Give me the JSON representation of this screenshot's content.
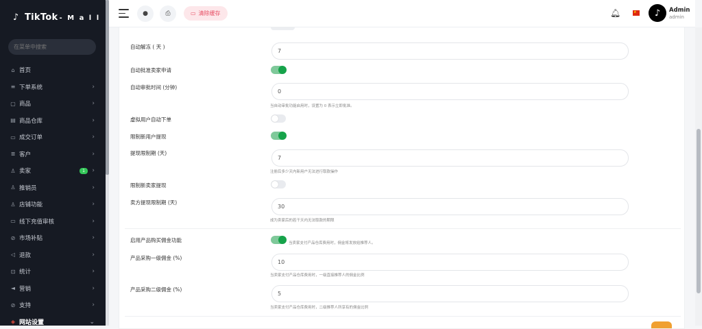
{
  "brand": {
    "icon": "tiktok-note-icon",
    "name": "TikTok",
    "suffix": "- M a l l"
  },
  "search": {
    "placeholder": "在菜单中搜索"
  },
  "menu": [
    {
      "label": "首页",
      "icon": "home-icon",
      "arrow": false
    },
    {
      "label": "下单系统",
      "icon": "filter-icon",
      "arrow": true
    },
    {
      "label": "商品",
      "icon": "bag-icon",
      "arrow": true
    },
    {
      "label": "商品仓库",
      "icon": "warehouse-icon",
      "arrow": true
    },
    {
      "label": "成交订单",
      "icon": "ticket-icon",
      "arrow": true
    },
    {
      "label": "客户",
      "icon": "customer-icon",
      "arrow": true
    },
    {
      "label": "卖家",
      "icon": "user-icon",
      "arrow": true,
      "badge": "1"
    },
    {
      "label": "推销员",
      "icon": "salesman-icon",
      "arrow": true
    },
    {
      "label": "店铺功能",
      "icon": "store-icon",
      "arrow": true
    },
    {
      "label": "线下充值审核",
      "icon": "card-icon",
      "arrow": true
    },
    {
      "label": "市场补贴",
      "icon": "link-icon",
      "arrow": true
    },
    {
      "label": "退款",
      "icon": "refund-icon",
      "arrow": true
    },
    {
      "label": "统计",
      "icon": "stats-icon",
      "arrow": true
    },
    {
      "label": "营销",
      "icon": "megaphone-icon",
      "arrow": true
    },
    {
      "label": "支持",
      "icon": "support-icon",
      "arrow": true
    },
    {
      "label": "网站设置",
      "icon": "laravel-icon",
      "arrow": true,
      "active": true
    }
  ],
  "topbar": {
    "clear_cache_label": "清除缓存",
    "user_name": "Admin",
    "user_role": "admin",
    "flag_color": "#de2910"
  },
  "settings": [
    {
      "label": "自动解冻 ( 天 )",
      "type": "input",
      "value": "7"
    },
    {
      "label": "自动批准卖家申请",
      "type": "toggle",
      "on": true
    },
    {
      "label": "自动审批时间 (分钟)",
      "type": "input",
      "value": "0",
      "hint": "当自动审批功能启用时，设置为 0 表示立即批准。"
    },
    {
      "label": "虚拟用户自动下单",
      "type": "toggle",
      "on": false
    },
    {
      "label": "限制新用户提现",
      "type": "toggle",
      "on": true
    },
    {
      "label": "提现限制期 (天)",
      "type": "input",
      "value": "7",
      "hint": "注册后多少天内新用户无法进行取款操作"
    },
    {
      "label": "限制新卖家提现",
      "type": "toggle",
      "on": false
    },
    {
      "label": "卖方提现限制期 (天)",
      "type": "input",
      "value": "30",
      "hint": "成为卖家后的若干天内无法取款的期限"
    },
    {
      "label": "启用产品购买佣金功能",
      "type": "toggle",
      "on": true,
      "inline_hint": "当卖家支付产品仓库费用时，佣金将发放给推荐人。"
    },
    {
      "label": "产品采购一级佣金 (%)",
      "type": "input",
      "value": "10",
      "hint": "当卖家支付产品仓库费用时，一级直接推荐人的佣金比例"
    },
    {
      "label": "产品采购二级佣金 (%)",
      "type": "input",
      "value": "5",
      "hint": "当卖家支付产品仓库费用时，二级推荐人所享有的佣金比例"
    }
  ],
  "colors": {
    "accent_green": "#16a34a",
    "sidebar_bg": "#161a23",
    "danger": "#e74d63"
  }
}
